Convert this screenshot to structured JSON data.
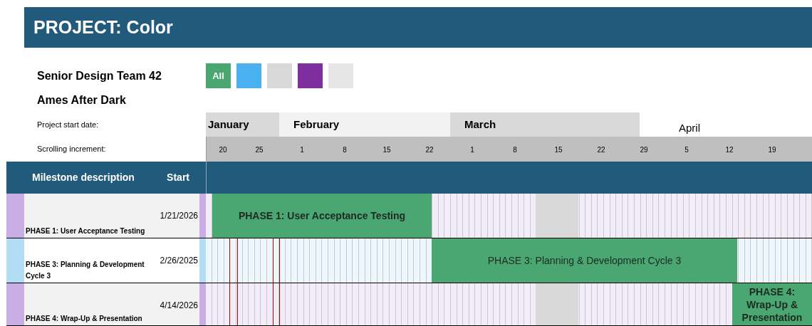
{
  "title": "PROJECT: Color",
  "team": "Senior Design Team 42",
  "project_name": "Ames After Dark",
  "filters": [
    {
      "label": "All",
      "color": "#4aa771"
    },
    {
      "color": "#4ab1f1"
    },
    {
      "color": "#d9d9d9"
    },
    {
      "color": "#7f2ea0"
    },
    {
      "color": "#e6e6e6"
    }
  ],
  "start_date_label": "Project start date:",
  "increment_label": "Scrolling increment:",
  "months": [
    {
      "label": "January",
      "kind": "band",
      "color": "#d9d9d9"
    },
    {
      "label": "February",
      "kind": "band",
      "color": "#f2f2f2"
    },
    {
      "label": "March",
      "kind": "band",
      "color": "#d9d9d9"
    },
    {
      "label": "April",
      "kind": "plain"
    }
  ],
  "days": [
    "20",
    "25",
    "1",
    "8",
    "15",
    "22",
    "1",
    "8",
    "15",
    "22",
    "29",
    "5",
    "12",
    "19"
  ],
  "columns": [
    "Milestone description",
    "Start"
  ],
  "rows": [
    {
      "description": "PHASE 1: User Acceptance Testing",
      "start": "1/21/2026",
      "color": "#c9aee6",
      "bar": {
        "label": "PHASE 1: User Acceptance Testing",
        "bold": true
      }
    },
    {
      "description": "PHASE 3: Planning & Development Cycle 3",
      "start": "2/26/2025",
      "color": "#b3dcf5",
      "bar": {
        "label": "PHASE 3: Planning & Development Cycle 3",
        "bold": false
      }
    },
    {
      "description": "PHASE 4: Wrap-Up & Presentation",
      "start": "4/14/2026",
      "color": "#c9aee6",
      "bar": {
        "label": "PHASE 4: Wrap-Up & Presentation",
        "bold": true
      }
    }
  ]
}
